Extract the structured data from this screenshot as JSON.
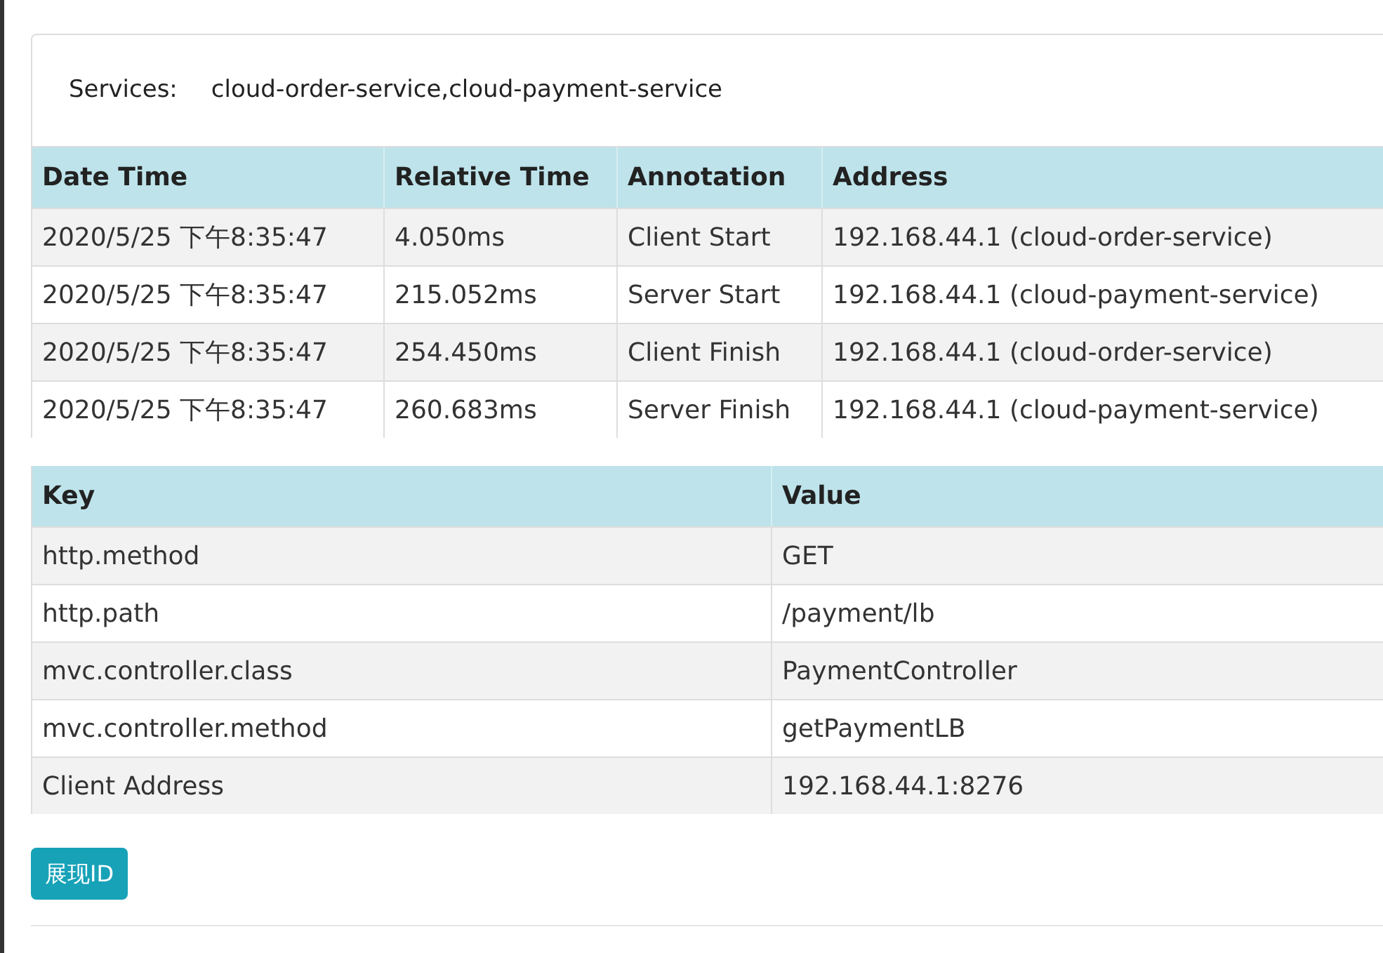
{
  "services": {
    "label": "Services:",
    "value": "cloud-order-service,cloud-payment-service"
  },
  "annotations_table": {
    "columns": [
      "Date Time",
      "Relative Time",
      "Annotation",
      "Address"
    ],
    "rows": [
      [
        "2020/5/25 下午8:35:47",
        "4.050ms",
        "Client Start",
        "192.168.44.1 (cloud-order-service)"
      ],
      [
        "2020/5/25 下午8:35:47",
        "215.052ms",
        "Server Start",
        "192.168.44.1 (cloud-payment-service)"
      ],
      [
        "2020/5/25 下午8:35:47",
        "254.450ms",
        "Client Finish",
        "192.168.44.1 (cloud-order-service)"
      ],
      [
        "2020/5/25 下午8:35:47",
        "260.683ms",
        "Server Finish",
        "192.168.44.1 (cloud-payment-service)"
      ]
    ]
  },
  "tags_table": {
    "columns": [
      "Key",
      "Value"
    ],
    "rows": [
      [
        "http.method",
        "GET"
      ],
      [
        "http.path",
        "/payment/lb"
      ],
      [
        "mvc.controller.class",
        "PaymentController"
      ],
      [
        "mvc.controller.method",
        "getPaymentLB"
      ],
      [
        "Client Address",
        "192.168.44.1:8276"
      ]
    ]
  },
  "button": "展现ID"
}
